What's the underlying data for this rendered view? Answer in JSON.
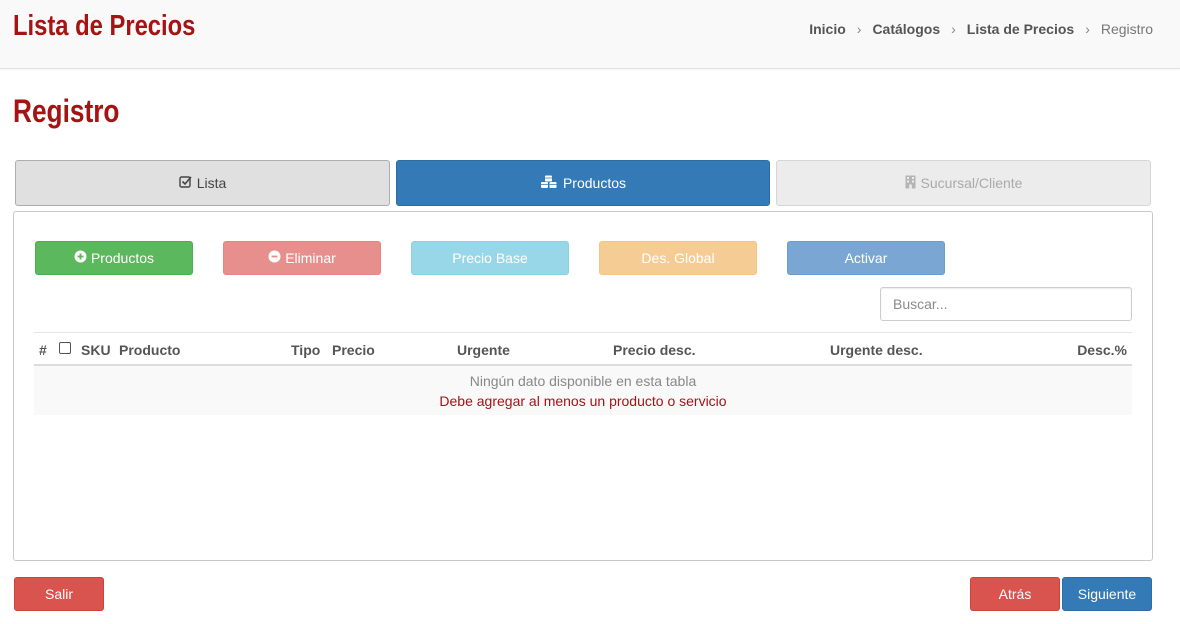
{
  "header": {
    "title": "Lista de Precios",
    "breadcrumb": [
      "Inicio",
      "Catálogos",
      "Lista de Precios",
      "Registro"
    ]
  },
  "page": {
    "heading": "Registro"
  },
  "tabs": [
    {
      "label": "Lista",
      "icon": "check-square-icon",
      "state": "default"
    },
    {
      "label": "Productos",
      "icon": "cubes-icon",
      "state": "active"
    },
    {
      "label": "Sucursal/Cliente",
      "icon": "building-icon",
      "state": "disabled"
    }
  ],
  "actions": {
    "add_products": "Productos",
    "delete": "Eliminar",
    "base_price": "Precio Base",
    "global_discount": "Des. Global",
    "activate": "Activar"
  },
  "search": {
    "placeholder": "Buscar...",
    "value": ""
  },
  "table": {
    "columns": [
      "#",
      "SKU",
      "Producto",
      "Tipo",
      "Precio",
      "Urgente",
      "Precio desc.",
      "Urgente desc.",
      "Desc.%"
    ],
    "empty_message": "Ningún dato disponible en esta tabla",
    "warning_message": "Debe agregar al menos un producto o servicio"
  },
  "footer": {
    "exit": "Salir",
    "back": "Atrás",
    "next": "Siguiente"
  },
  "colors": {
    "brand_red": "#a51313",
    "primary": "#337ab7",
    "success": "#5cb85c",
    "danger": "#d9534f"
  }
}
